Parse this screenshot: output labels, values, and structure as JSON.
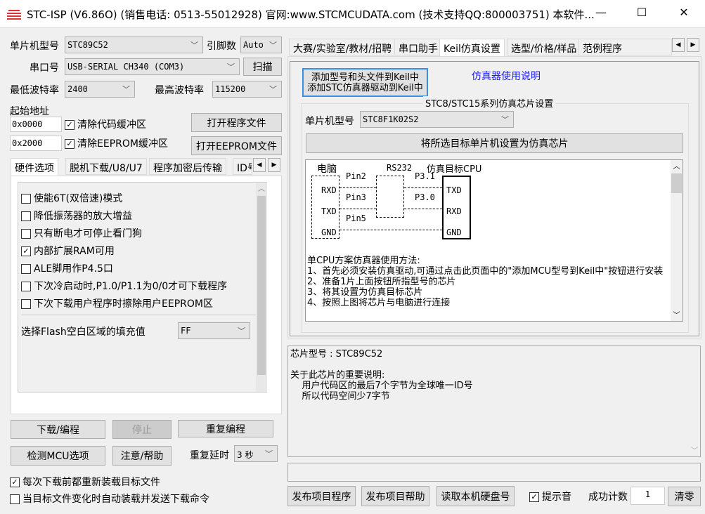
{
  "window": {
    "title": "STC-ISP (V6.86O) (销售电话: 0513-55012928) 官网:www.STCMCUDATA.com (技术支持QQ:800003751) 本软件...",
    "min": "—",
    "max": "☐",
    "close": "✕"
  },
  "left": {
    "mcu_label": "单片机型号",
    "mcu_value": "STC89C52",
    "pins_label": "引脚数",
    "pins_value": "Auto",
    "port_label": "串口号",
    "port_value": "USB-SERIAL CH340 (COM3)",
    "scan": "扫描",
    "min_baud_label": "最低波特率",
    "min_baud": "2400",
    "max_baud_label": "最高波特率",
    "max_baud": "115200",
    "start_addr_label": "起始地址",
    "addr1": "0x0000",
    "clear_code": "清除代码缓冲区",
    "open_prog": "打开程序文件",
    "addr2": "0x2000",
    "clear_eeprom": "清除EEPROM缓冲区",
    "open_eeprom": "打开EEPROM文件",
    "tabs": [
      "硬件选项",
      "脱机下载/U8/U7",
      "程序加密后传输",
      "ID号"
    ],
    "options": [
      {
        "label": "使能6T(双倍速)模式",
        "checked": false
      },
      {
        "label": "降低振荡器的放大增益",
        "checked": false
      },
      {
        "label": "只有断电才可停止看门狗",
        "checked": false
      },
      {
        "label": "内部扩展RAM可用",
        "checked": true
      },
      {
        "label": "ALE脚用作P4.5口",
        "checked": false
      },
      {
        "label": "下次冷启动时,P1.0/P1.1为0/0才可下载程序",
        "checked": false
      },
      {
        "label": "下次下载用户程序时擦除用户EEPROM区",
        "checked": false
      }
    ],
    "fill_label": "选择Flash空白区域的填充值",
    "fill_value": "FF",
    "download": "下载/编程",
    "stop": "停止",
    "repeat": "重复编程",
    "detect": "检测MCU选项",
    "help": "注意/帮助",
    "delay_label": "重复延时",
    "delay_value": "3 秒",
    "reload": "每次下载前都重新装载目标文件",
    "auto_load": "当目标文件变化时自动装载并发送下载命令"
  },
  "right": {
    "tabs": [
      "大赛/实验室/教材/招聘",
      "串口助手",
      "Keil仿真设置",
      "选型/价格/样品",
      "范例程序"
    ],
    "add_keil_1": "添加型号和头文件到Keil中",
    "add_keil_2": "添加STC仿真器驱动到Keil中",
    "emu_help": "仿真器使用说明",
    "group_title": "STC8/STC15系列仿真芯片设置",
    "mcu_label": "单片机型号",
    "mcu_value": "STC8F1K02S2",
    "set_emu": "将所选目标单片机设置为仿真芯片",
    "diagram": {
      "pc": "电脑",
      "rs232": "RS232",
      "target": "仿真目标CPU",
      "pin2": "Pin2",
      "pin3": "Pin3",
      "pin5": "Pin5",
      "p31": "P3.1",
      "p30": "P3.0",
      "rxd": "RXD",
      "txd": "TXD",
      "gnd": "GND"
    },
    "instructions": [
      "单CPU方案仿真器使用方法:",
      "1、首先必须安装仿真驱动,可通过点击此页面中的\"添加MCU型号到Keil中\"按钮进行安装",
      "2、准备1片上面按钮所指型号的芯片",
      "3、将其设置为仿真目标芯片",
      "4、按照上图将芯片与电脑进行连接"
    ],
    "info": [
      "芯片型号 : STC89C52",
      "",
      "关于此芯片的重要说明:",
      "    用户代码区的最后7个字节为全球唯一ID号",
      "    所以代码空间少7字节"
    ],
    "publish_prog": "发布项目程序",
    "publish_help": "发布项目帮助",
    "read_disk": "读取本机硬盘号",
    "sound": "提示音",
    "count_label": "成功计数",
    "count": "1",
    "clear": "清零"
  }
}
